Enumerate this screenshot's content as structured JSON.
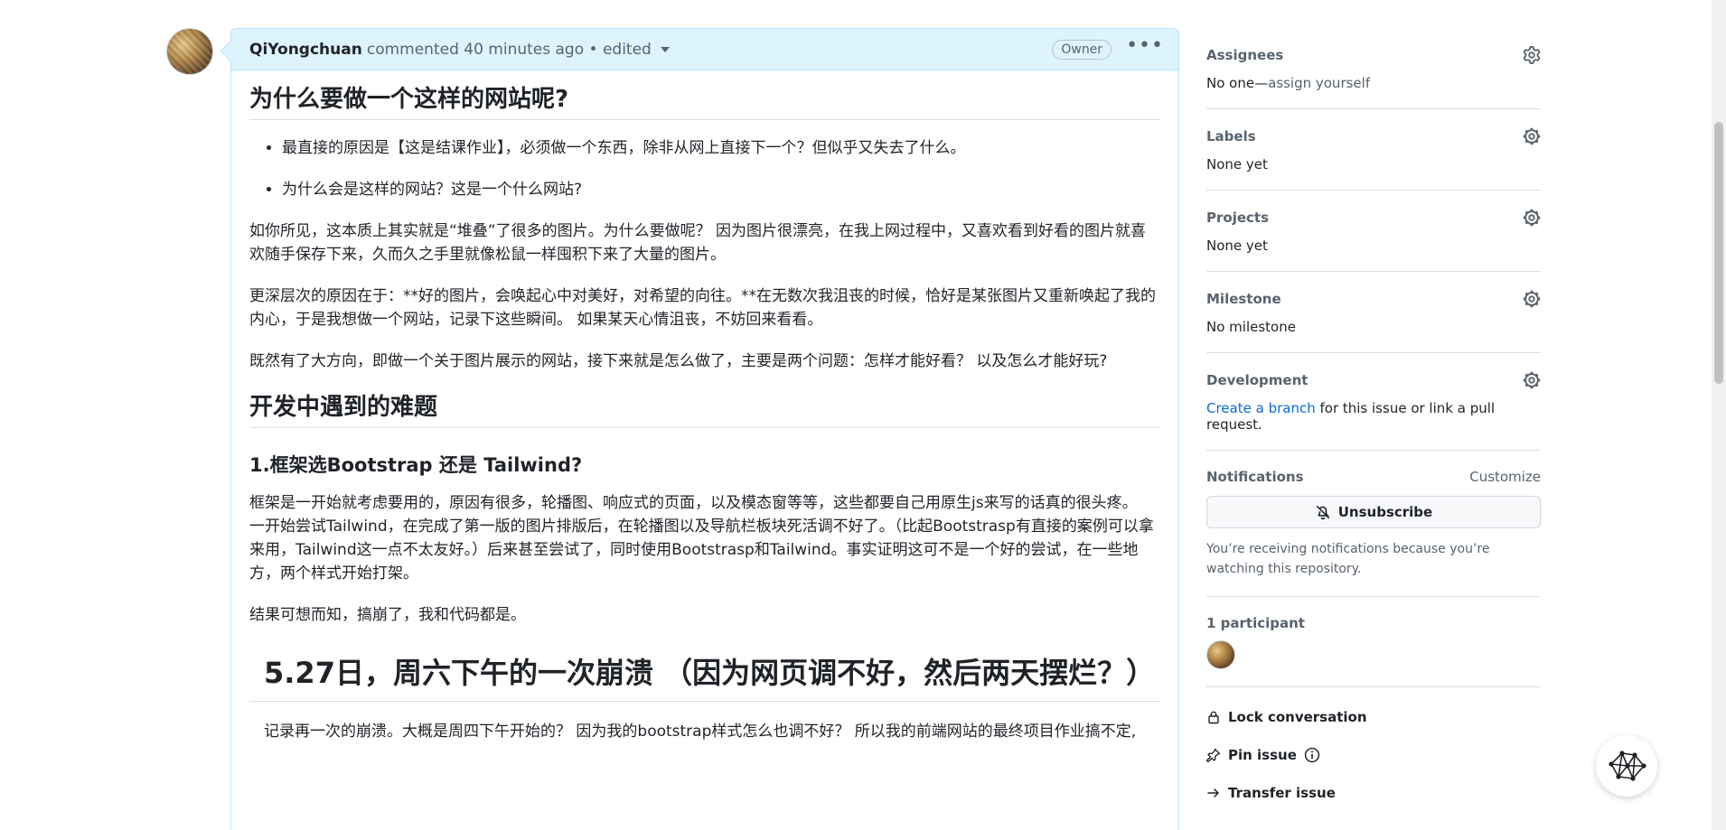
{
  "comment": {
    "author": "QiYongchuan",
    "meta": "commented 40 minutes ago • edited",
    "owner_badge": "Owner",
    "more_label": "•••",
    "h2_1": "为什么要做一个这样的网站呢?",
    "bullets": [
      "最直接的原因是【这是结课作业】，必须做一个东西，除非从网上直接下一个？但似乎又失去了什么。",
      "为什么会是这样的网站？这是一个什么网站?"
    ],
    "p1": "如你所见，这本质上其实就是“堆叠”了很多的图片。为什么要做呢？ 因为图片很漂亮，在我上网过程中，又喜欢看到好看的图片就喜欢随手保存下来，久而久之手里就像松鼠一样囤积下来了大量的图片。",
    "p2": "更深层次的原因在于：**好的图片，会唤起心中对美好，对希望的向往。**在无数次我沮丧的时候，恰好是某张图片又重新唤起了我的内心，于是我想做一个网站，记录下这些瞬间。 如果某天心情沮丧，不妨回来看看。",
    "p3": "既然有了大方向，即做一个关于图片展示的网站，接下来就是怎么做了，主要是两个问题：怎样才能好看？ 以及怎么才能好玩?",
    "h2_2": "开发中遇到的难题",
    "h3_1": "1.框架选Bootstrap 还是 Tailwind?",
    "p4": "框架是一开始就考虑要用的，原因有很多，轮播图、响应式的页面，以及模态窗等等，这些都要自己用原生js来写的话真的很头疼。",
    "p5": "一开始尝试Tailwind，在完成了第一版的图片排版后，在轮播图以及导航栏板块死活调不好了。（比起Bootstrasp有直接的案例可以拿来用，Tailwind这一点不太友好。）后来甚至尝试了，同时使用Bootstrasp和Tailwind。事实证明这可不是一个好的尝试，在一些地方，两个样式开始打架。",
    "p6": "结果可想而知，搞崩了，我和代码都是。",
    "h1_1": "5.27日，周六下午的一次崩溃 （因为网页调不好，然后两天摆烂？）",
    "p7": "记录再一次的崩溃。大概是周四下午开始的？ 因为我的bootstrap样式怎么也调不好？ 所以我的前端网站的最终项目作业搞不定,"
  },
  "sidebar": {
    "assignees_label": "Assignees",
    "assignees_none": "No one—",
    "assignees_link": "assign yourself",
    "labels_label": "Labels",
    "labels_value": "None yet",
    "projects_label": "Projects",
    "projects_value": "None yet",
    "milestone_label": "Milestone",
    "milestone_value": "No milestone",
    "development_label": "Development",
    "development_link": "Create a branch",
    "development_rest": " for this issue or link a pull request.",
    "notifications_label": "Notifications",
    "customize_label": "Customize",
    "unsubscribe_label": "Unsubscribe",
    "notif_note": "You’re receiving notifications because you’re watching this repository.",
    "participants_label": "1 participant",
    "lock_label": "Lock conversation",
    "pin_label": "Pin issue",
    "transfer_label": "Transfer issue"
  },
  "colors": {
    "header_bg": "#ddf4ff",
    "border_blue": "#b6e3ff",
    "link": "#0969da",
    "muted": "#59636e"
  }
}
